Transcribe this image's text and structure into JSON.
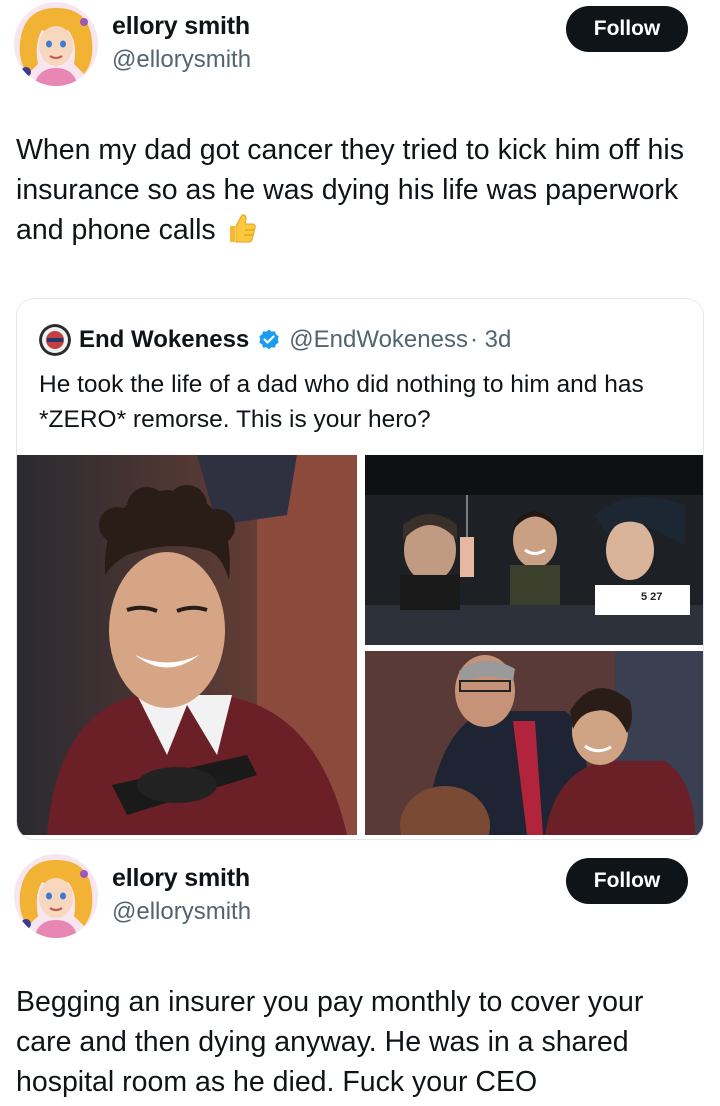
{
  "post1": {
    "display_name": "ellory smith",
    "handle": "@ellorysmith",
    "follow_label": "Follow",
    "text": "When my dad got cancer they tried to kick him off his insurance so as he was dying his life was paperwork and phone calls",
    "emoji": "thumbs-up-icon"
  },
  "quote": {
    "display_name": "End Wokeness",
    "handle": "@EndWokeness",
    "time": "· 3d",
    "verified": true,
    "text": "He took the life of a dad who did nothing to him and has *ZERO* remorse. This is your hero?",
    "photo_note": "5 27"
  },
  "post2": {
    "display_name": "ellory smith",
    "handle": "@ellorysmith",
    "follow_label": "Follow",
    "text": "Begging an insurer you pay monthly to cover your care and then dying anyway. He was in a shared hospital room as he died. Fuck your CEO"
  },
  "colors": {
    "text": "#0f1419",
    "secondary": "#536471",
    "verified": "#1d9bf0",
    "follow_bg": "#0f1419"
  }
}
